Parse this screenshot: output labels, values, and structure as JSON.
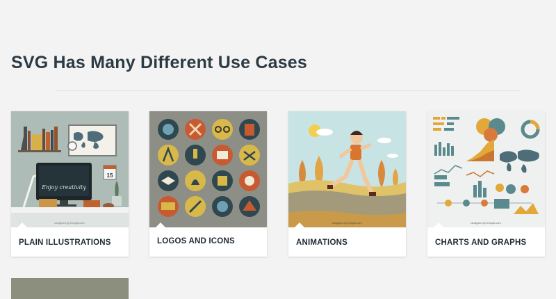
{
  "section": {
    "title": "SVG Has Many Different Use Cases"
  },
  "cards": [
    {
      "label": "PLAIN ILLUSTRATIONS"
    },
    {
      "label": "LOGOS AND ICONS"
    },
    {
      "label": "ANIMATIONS"
    },
    {
      "label": "CHARTS AND GRAPHS"
    }
  ],
  "thumb_text": {
    "calendar_day": "15",
    "screen_text": "Enjoy creativity",
    "freepik_credit": "designed by freepik.com"
  },
  "colors": {
    "background": "#f3f3f3",
    "heading": "#2c3a44",
    "card_bg": "#ffffff"
  }
}
